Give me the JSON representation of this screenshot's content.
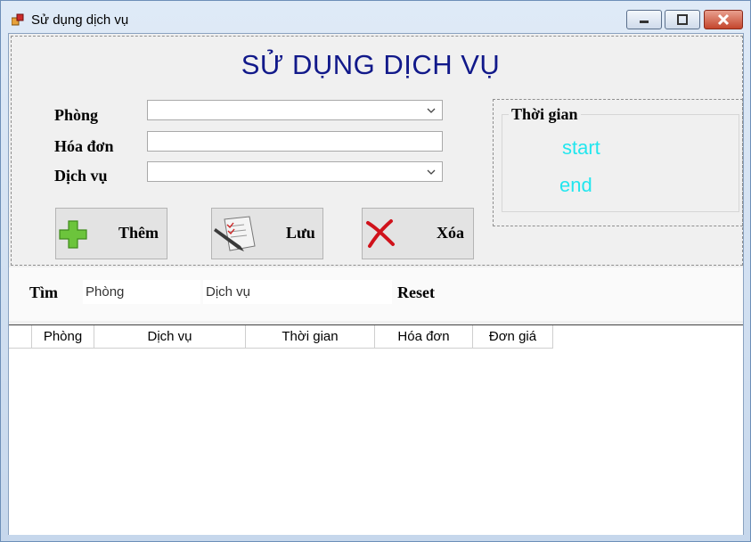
{
  "window": {
    "title": "Sử dụng dịch vụ",
    "controls": [
      "minimize-icon",
      "maximize-icon",
      "close-icon"
    ]
  },
  "form": {
    "heading": "SỬ DỤNG DỊCH VỤ",
    "fields": {
      "phong_label": "Phòng",
      "phong_value": "",
      "hoadon_label": "Hóa đơn",
      "hoadon_value": "",
      "dichvu_label": "Dịch vụ",
      "dichvu_value": ""
    },
    "buttons": {
      "add_label": "Thêm",
      "save_label": "Lưu",
      "delete_label": "Xóa"
    },
    "time_group": {
      "title": "Thời gian",
      "start": "start",
      "end": "end"
    }
  },
  "search": {
    "label": "Tìm",
    "phong_box": "Phòng",
    "dichvu_box": "Dịch vụ",
    "reset_label": "Reset"
  },
  "grid": {
    "columns": [
      "Phòng",
      "Dịch vụ",
      "Thời gian",
      "Hóa đơn",
      "Đơn giá"
    ],
    "rows": []
  },
  "colors": {
    "heading": "#11198a",
    "time_text": "#22e6ee",
    "add_icon": "#6cc43c",
    "delete_icon": "#d0121b"
  }
}
